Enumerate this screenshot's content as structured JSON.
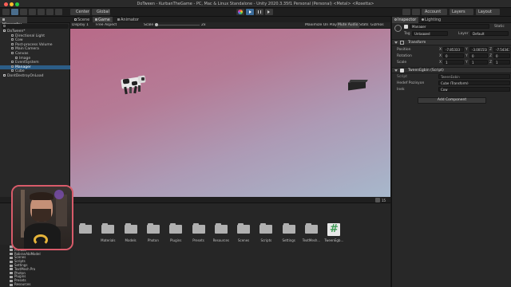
{
  "window": {
    "title": "DoTween - KurbanTheGame - PC, Mac & Linux Standalone - Unity 2020.3.35f1 Personal (Personal) <Metal> <Rosetta>"
  },
  "toolbar": {
    "center_label": "Center",
    "global_label": "Global",
    "account_label": "Account",
    "layers_label": "Layers",
    "layout_label": "Layout"
  },
  "hierarchy": {
    "tab_label": "Hierarchy",
    "items": [
      {
        "label": "DoTween*",
        "indent": 0,
        "selected": false
      },
      {
        "label": "Directional Light",
        "indent": 2,
        "selected": false
      },
      {
        "label": "Cow",
        "indent": 2,
        "selected": false
      },
      {
        "label": "Post-process Volume",
        "indent": 2,
        "selected": false
      },
      {
        "label": "Main Camera",
        "indent": 2,
        "selected": false
      },
      {
        "label": "Canvas",
        "indent": 2,
        "selected": false
      },
      {
        "label": "Image",
        "indent": 3,
        "selected": false
      },
      {
        "label": "EventSystem",
        "indent": 2,
        "selected": false
      },
      {
        "label": "Manager",
        "indent": 2,
        "selected": true
      },
      {
        "label": "Cube",
        "indent": 2,
        "selected": false
      },
      {
        "label": "DontDestroyOnLoad",
        "indent": 0,
        "selected": false
      }
    ]
  },
  "center_tabs": {
    "scene": "Scene",
    "game": "Game",
    "animator": "Animator"
  },
  "game_toolbar": {
    "display": "Display 1",
    "aspect": "Free Aspect",
    "scale_label": "Scale",
    "scale_value": "2x",
    "maximize": "Maximize On Play",
    "mute": "Mute Audio",
    "stats": "Stats",
    "gizmos": "Gizmos"
  },
  "inspector": {
    "tab_inspector": "Inspector",
    "tab_lighting": "Lighting",
    "object_name": "Manager",
    "static_label": "Static",
    "tag_label": "Tag",
    "tag_value": "Untagged",
    "layer_label": "Layer",
    "layer_value": "Default",
    "transform_title": "Transform",
    "position_label": "Position",
    "rotation_label": "Rotation",
    "scale_label": "Scale",
    "position": {
      "x": "-7.85333",
      "y": "-3.001518",
      "z": "-7.543437"
    },
    "rotation": {
      "x": "0",
      "y": "0",
      "z": "0"
    },
    "scale": {
      "x": "1",
      "y": "1",
      "z": "1"
    },
    "axis_x": "X",
    "axis_y": "Y",
    "axis_z": "Z",
    "script_title": "TweenEgbin (Script)",
    "script_label": "Script",
    "script_value": "TweenEgbin",
    "field1_label": "Hedef Pozisyon",
    "field1_value": "Cube (Transform)",
    "field2_label": "Inek",
    "field2_value": "Cow",
    "add_component": "Add Component"
  },
  "project": {
    "tree_items": [
      "Fonts",
      "Prefabs",
      "RobranAbiModel",
      "Scenes",
      "Scripts",
      "Settings",
      "TextMesh Pro",
      "Photon",
      "Plugins",
      "Presets",
      "Resources"
    ],
    "folders": [
      {
        "label": "",
        "kind": "unity"
      },
      {
        "label": "Materials",
        "kind": "folder"
      },
      {
        "label": "Models",
        "kind": "folder"
      },
      {
        "label": "Photon",
        "kind": "folder"
      },
      {
        "label": "Plugins",
        "kind": "folder"
      },
      {
        "label": "Presets",
        "kind": "folder"
      },
      {
        "label": "Resources",
        "kind": "folder"
      },
      {
        "label": "Scenes",
        "kind": "folder"
      },
      {
        "label": "Scripts",
        "kind": "folder"
      },
      {
        "label": "Settings",
        "kind": "folder"
      },
      {
        "label": "TextMesh...",
        "kind": "folder"
      },
      {
        "label": "TweenEgb...",
        "kind": "script"
      }
    ],
    "count_badge": "15"
  },
  "colors": {
    "accent_select": "#2c5d87",
    "script_icon": "#3d9a54"
  }
}
